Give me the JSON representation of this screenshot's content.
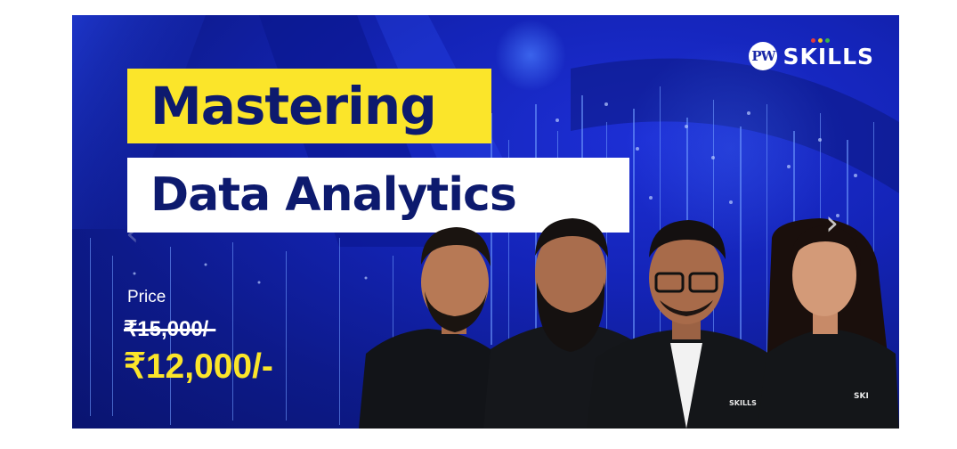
{
  "banner": {
    "title_line1": "Mastering",
    "title_line2": "Data Analytics",
    "price_label": "Price",
    "old_price": "₹15,000/-",
    "new_price": "₹12,000/-",
    "logo": {
      "mark": "PW",
      "text": "SKILLS",
      "dot_colors": [
        "#e63b3b",
        "#f5c518",
        "#3bb54a"
      ]
    },
    "shirt_logo": "SKILLS",
    "shirt_logo_short": "SKI",
    "colors": {
      "background": "#1424b8",
      "highlight_yellow": "#fbe52a",
      "title_text": "#0d1a6e"
    }
  },
  "carousel": {
    "prev_icon": "chevron-left-icon",
    "next_icon": "chevron-right-icon"
  }
}
